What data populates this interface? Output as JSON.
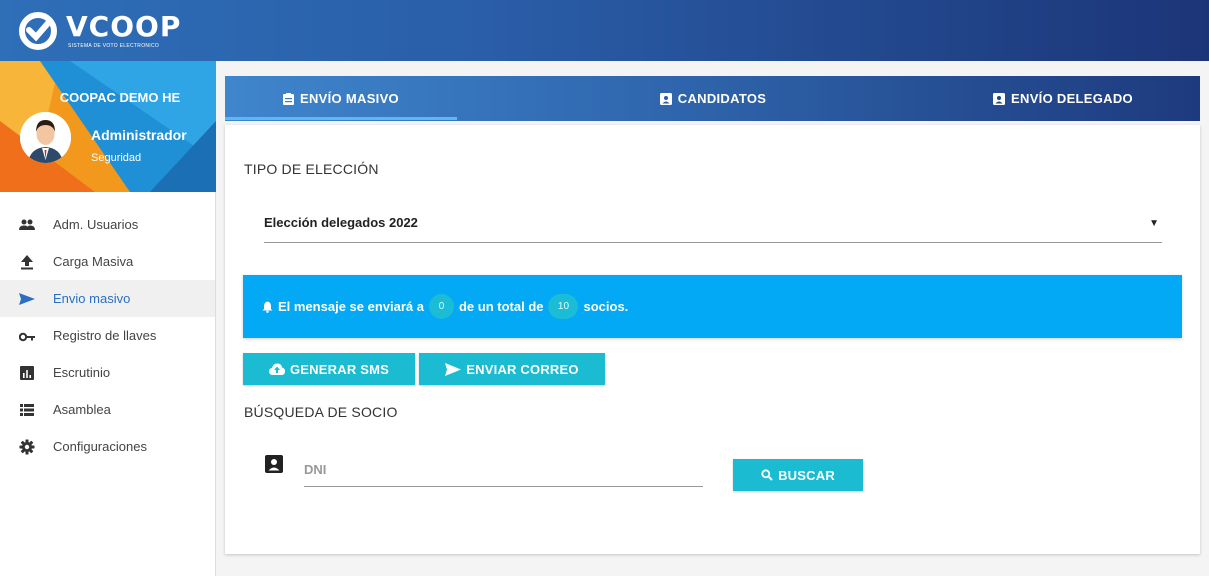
{
  "brand": {
    "name": "VCOOP",
    "tagline": "SISTEMA DE VOTO ELECTRONICO"
  },
  "profile": {
    "org": "COOPAC DEMO HE",
    "role": "Administrador",
    "subtitle": "Seguridad"
  },
  "sidebar": {
    "items": [
      {
        "label": "Adm. Usuarios",
        "icon": "users-icon"
      },
      {
        "label": "Carga Masiva",
        "icon": "upload-icon"
      },
      {
        "label": "Envio masivo",
        "icon": "send-icon",
        "active": true
      },
      {
        "label": "Registro de llaves",
        "icon": "key-icon"
      },
      {
        "label": "Escrutinio",
        "icon": "chart-icon"
      },
      {
        "label": "Asamblea",
        "icon": "list-icon"
      },
      {
        "label": "Configuraciones",
        "icon": "gear-icon"
      }
    ]
  },
  "tabs": [
    {
      "label": "ENVÍO MASIVO",
      "icon": "clipboard-icon",
      "active": true
    },
    {
      "label": "CANDIDATOS",
      "icon": "id-card-icon"
    },
    {
      "label": "ENVÍO DELEGADO",
      "icon": "id-card-icon"
    }
  ],
  "election": {
    "section_title": "TIPO DE ELECCIÓN",
    "selected": "Elección delegados 2022"
  },
  "alert": {
    "prefix": "El mensaje se enviará a",
    "count": "0",
    "middle": "de un total de",
    "total": "10",
    "suffix": "socios."
  },
  "actions": {
    "sms_label": "GENERAR SMS",
    "mail_label": "ENVIAR CORREO"
  },
  "search": {
    "section_title": "BÚSQUEDA DE SOCIO",
    "placeholder": "DNI",
    "value": "",
    "button_label": "BUSCAR"
  },
  "colors": {
    "accent": "#1bbcd2",
    "alert": "#03a9f4",
    "nav_start": "#3f86cd",
    "nav_end": "#1e3a7e"
  }
}
